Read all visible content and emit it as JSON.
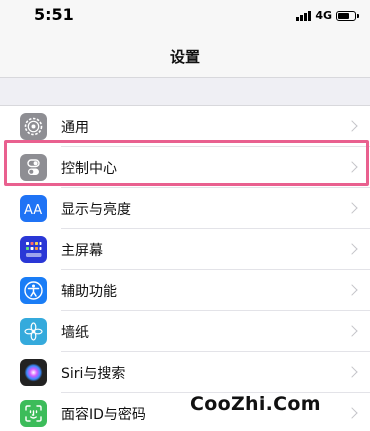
{
  "status_bar": {
    "time": "5:51",
    "network": "4G"
  },
  "nav": {
    "title": "设置"
  },
  "settings": [
    {
      "label": "通用",
      "icon": "gear-icon",
      "color": "#8e8e93"
    },
    {
      "label": "控制中心",
      "icon": "toggle-switches-icon",
      "color": "#8e8e93"
    },
    {
      "label": "显示与亮度",
      "icon": "aa-text-icon",
      "color": "#1f73f5"
    },
    {
      "label": "主屏幕",
      "icon": "home-grid-icon",
      "color": "#2a37d6"
    },
    {
      "label": "辅助功能",
      "icon": "accessibility-icon",
      "color": "#1a7df6"
    },
    {
      "label": "墙纸",
      "icon": "flower-icon",
      "color": "#35aadc"
    },
    {
      "label": "Siri与搜索",
      "icon": "siri-icon",
      "color": "#222222"
    },
    {
      "label": "面容ID与密码",
      "icon": "face-id-icon",
      "color": "#3cbc5a"
    }
  ],
  "highlight_color": "#e9608f",
  "watermark": "CooZhi.Com"
}
